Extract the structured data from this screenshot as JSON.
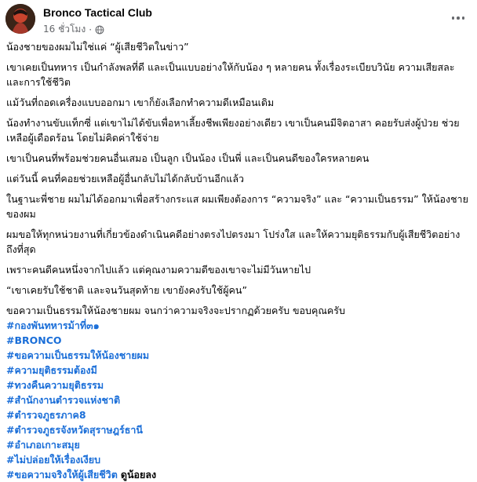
{
  "post": {
    "author": "Bronco Tactical Club",
    "time": "16 ชั่วโมง",
    "paragraphs": [
      "น้องชายของผมไม่ใช่แค่ “ผู้เสียชีวิตในข่าว”",
      "เขาเคยเป็นทหาร เป็นกำลังพลที่ดี และเป็นแบบอย่างให้กับน้อง ๆ หลายคน ทั้งเรื่องระเบียบวินัย ความเสียสละ และการใช้ชีวิต",
      "แม้วันที่ถอดเครื่องแบบออกมา เขาก็ยังเลือกทำความดีเหมือนเดิม",
      "น้องทำงานขับแท็กซี่ แต่เขาไม่ได้ขับเพื่อหาเลี้ยงชีพเพียงอย่างเดียว เขาเป็นคนมีจิตอาสา คอยรับส่งผู้ป่วย ช่วยเหลือผู้เดือดร้อน โดยไม่คิดค่าใช้จ่าย",
      "เขาเป็นคนที่พร้อมช่วยคนอื่นเสมอ เป็นลูก เป็นน้อง เป็นพี่ และเป็นคนดีของใครหลายคน",
      "แต่วันนี้ คนที่คอยช่วยเหลือผู้อื่นกลับไม่ได้กลับบ้านอีกแล้ว",
      "ในฐานะพี่ชาย ผมไม่ได้ออกมาเพื่อสร้างกระแส ผมเพียงต้องการ “ความจริง” และ “ความเป็นธรรม” ให้น้องชายของผม",
      "ผมขอให้ทุกหน่วยงานที่เกี่ยวข้องดำเนินคดีอย่างตรงไปตรงมา โปร่งใส และให้ความยุติธรรมกับผู้เสียชีวิตอย่างถึงที่สุด",
      "เพราะคนดีคนหนึ่งจากไปแล้ว แต่คุณงามความดีของเขาจะไม่มีวันหายไป",
      "“เขาเคยรับใช้ชาติ และจนวันสุดท้าย เขายังคงรับใช้ผู้คน”"
    ],
    "closing": "ขอความเป็นธรรมให้น้องชายผม จนกว่าความจริงจะปรากฏด้วยครับ ขอบคุณครับ",
    "hashtags": [
      "#กองพันทหารม้าที่๓๑",
      "#BRONCO",
      "#ขอความเป็นธรรมให้น้องชายผม",
      "#ความยุติธรรมต้องมี",
      "#ทวงคืนความยุติธรรม",
      "#สำนักงานตำรวจแห่งชาติ",
      "#ตำรวจภูธรภาค8",
      "#ตำรวจภูธรจังหวัดสุราษฎร์ธานี",
      "#อำเภอเกาะสมุย",
      "#ไม่ปล่อยให้เรื่องเงียบ"
    ],
    "last_hashtag": "#ขอความจริงให้ผู้เสียชีวิต",
    "see_more": "ดูน้อยลง"
  },
  "colors": {
    "hashtag": "#1a6ed8",
    "meta": "#65676b",
    "text": "#050505"
  },
  "icons": {
    "privacy": "globe-icon",
    "menu": "more-options-icon"
  }
}
